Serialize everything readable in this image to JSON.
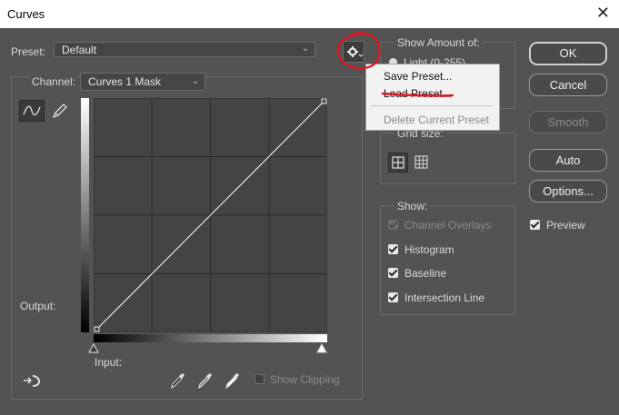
{
  "window": {
    "title": "Curves",
    "close_glyph": "✕"
  },
  "preset": {
    "label": "Preset:",
    "value": "Default"
  },
  "channel": {
    "label": "Channel:",
    "value": "Curves 1 Mask"
  },
  "graph": {
    "output_label": "Output:",
    "input_label": "Input:",
    "show_clipping_label": "Show Clipping",
    "show_clipping": false
  },
  "preset_menu": {
    "items": [
      {
        "label": "Save Preset...",
        "enabled": true
      },
      {
        "label": "Load Preset...",
        "enabled": true
      },
      {
        "label": "Delete Current Preset",
        "enabled": false
      }
    ]
  },
  "show_amount": {
    "title": "Show Amount of:",
    "option_partial": "Light  (0-255)"
  },
  "grid_size": {
    "title": "Grid size:"
  },
  "show": {
    "title": "Show:",
    "options": [
      {
        "label": "Channel Overlays",
        "checked": true,
        "enabled": false
      },
      {
        "label": "Histogram",
        "checked": true,
        "enabled": true
      },
      {
        "label": "Baseline",
        "checked": true,
        "enabled": true
      },
      {
        "label": "Intersection Line",
        "checked": true,
        "enabled": true
      }
    ]
  },
  "buttons": {
    "ok": "OK",
    "cancel": "Cancel",
    "smooth": "Smooth",
    "auto": "Auto",
    "options": "Options..."
  },
  "preview": {
    "label": "Preview",
    "checked": true
  },
  "annotation": {
    "color": "#e0141e"
  }
}
